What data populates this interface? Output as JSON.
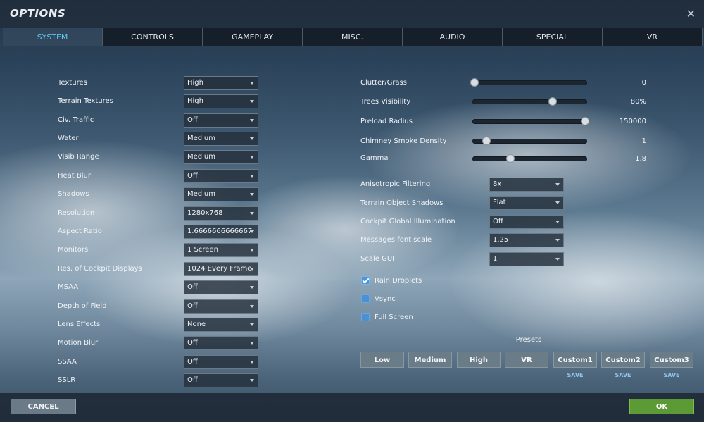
{
  "window": {
    "title": "OPTIONS",
    "close_glyph": "✕"
  },
  "tabs": [
    {
      "label": "SYSTEM",
      "active": true
    },
    {
      "label": "CONTROLS"
    },
    {
      "label": "GAMEPLAY"
    },
    {
      "label": "MISC."
    },
    {
      "label": "AUDIO"
    },
    {
      "label": "SPECIAL"
    },
    {
      "label": "VR"
    }
  ],
  "left_settings": [
    {
      "label": "Textures",
      "value": "High"
    },
    {
      "label": "Terrain Textures",
      "value": "High"
    },
    {
      "label": "Civ. Traffic",
      "value": "Off"
    },
    {
      "label": "Water",
      "value": "Medium"
    },
    {
      "label": "Visib Range",
      "value": "Medium"
    },
    {
      "label": "Heat Blur",
      "value": "Off"
    },
    {
      "label": "Shadows",
      "value": "Medium"
    },
    {
      "label": "Resolution",
      "value": "1280x768"
    },
    {
      "label": "Aspect Ratio",
      "value": "1.6666666666667"
    },
    {
      "label": "Monitors",
      "value": "1 Screen"
    },
    {
      "label": "Res. of Cockpit Displays",
      "value": "1024 Every Frame"
    },
    {
      "label": "MSAA",
      "value": "Off"
    },
    {
      "label": "Depth of Field",
      "value": "Off"
    },
    {
      "label": "Lens Effects",
      "value": "None"
    },
    {
      "label": "Motion Blur",
      "value": "Off"
    },
    {
      "label": "SSAA",
      "value": "Off"
    },
    {
      "label": "SSLR",
      "value": "Off"
    }
  ],
  "sliders": [
    {
      "label": "Clutter/Grass",
      "value": "0",
      "fraction": 0.02
    },
    {
      "label": "Trees Visibility",
      "value": "80%",
      "fraction": 0.7
    },
    {
      "label": "Preload Radius",
      "value": "150000",
      "fraction": 0.98
    },
    {
      "label": "Chimney Smoke Density",
      "value": "1",
      "fraction": 0.12
    },
    {
      "label": "Gamma",
      "value": "1.8",
      "fraction": 0.33
    }
  ],
  "right_settings": [
    {
      "label": "Anisotropic Filtering",
      "value": "8x"
    },
    {
      "label": "Terrain Object Shadows",
      "value": "Flat"
    },
    {
      "label": "Cockpit Global Illumination",
      "value": "Off"
    },
    {
      "label": "Messages font scale",
      "value": "1.25"
    },
    {
      "label": "Scale GUI",
      "value": "1"
    }
  ],
  "checkboxes": [
    {
      "label": "Rain Droplets",
      "checked": true
    },
    {
      "label": "Vsync",
      "checked": false
    },
    {
      "label": "Full Screen",
      "checked": false
    }
  ],
  "presets": {
    "title": "Presets",
    "buttons": [
      "Low",
      "Medium",
      "High",
      "VR",
      "Custom1",
      "Custom2",
      "Custom3"
    ],
    "save_label": "SAVE"
  },
  "footer": {
    "cancel_label": "CANCEL",
    "ok_label": "OK"
  },
  "colors": {
    "active_tab": "#5fc8ee",
    "ok_button": "#5b9a35",
    "checkbox": "#4e95d8",
    "save_link": "#8ec6ee"
  },
  "icons": {
    "close": "close-icon",
    "dropdown": "chevron-down-icon",
    "check": "checkmark-icon"
  }
}
